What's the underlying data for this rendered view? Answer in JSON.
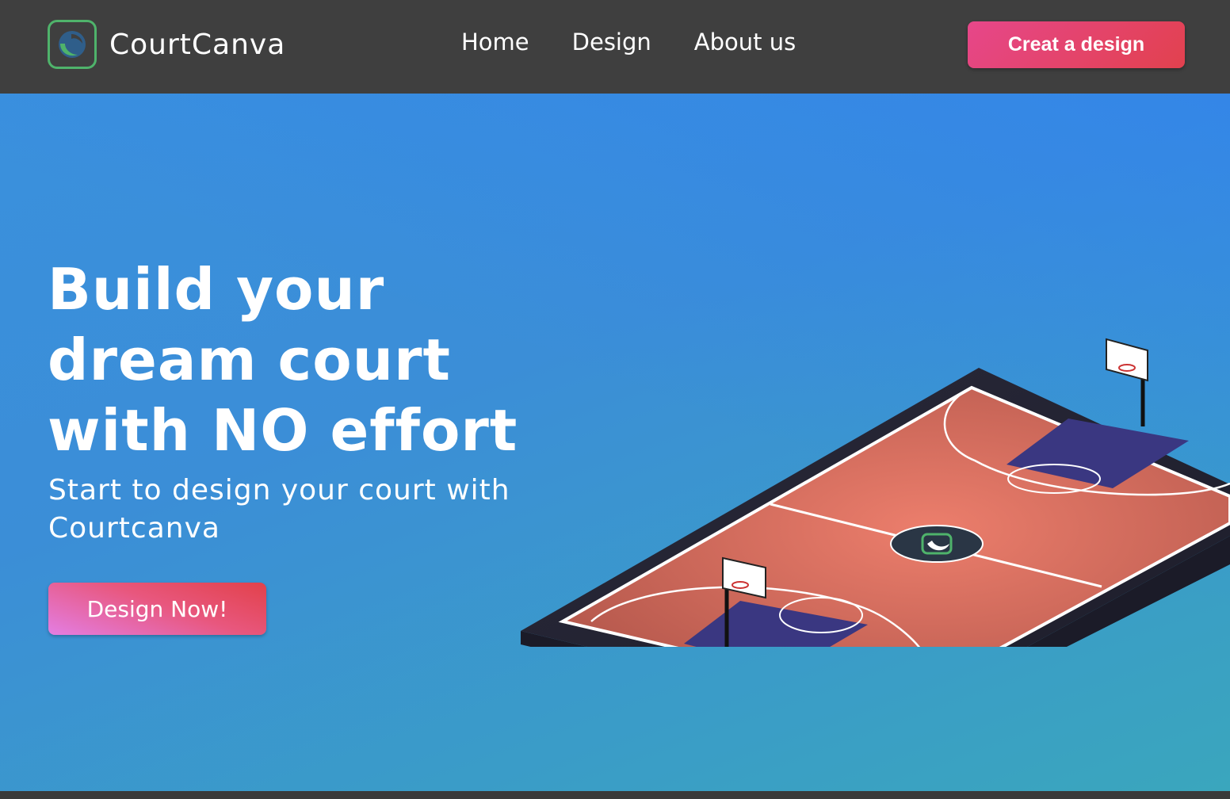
{
  "header": {
    "brand_name": "CourtCanva",
    "nav": [
      {
        "label": "Home"
      },
      {
        "label": "Design"
      },
      {
        "label": "About us"
      }
    ],
    "cta_label": "Creat a design"
  },
  "hero": {
    "headline": "Build your dream court with NO effort",
    "subtext": "Start to design your court with Courtcanva",
    "cta_label": "Design Now!"
  },
  "colors": {
    "header_bg": "#3f3f3f",
    "accent_green": "#4fb36b",
    "button_pink": "#e6478a",
    "hero_blue": "#3a90dd"
  },
  "icons": {
    "logo": "courtcanva-logo-icon",
    "court": "basketball-court-illustration"
  }
}
